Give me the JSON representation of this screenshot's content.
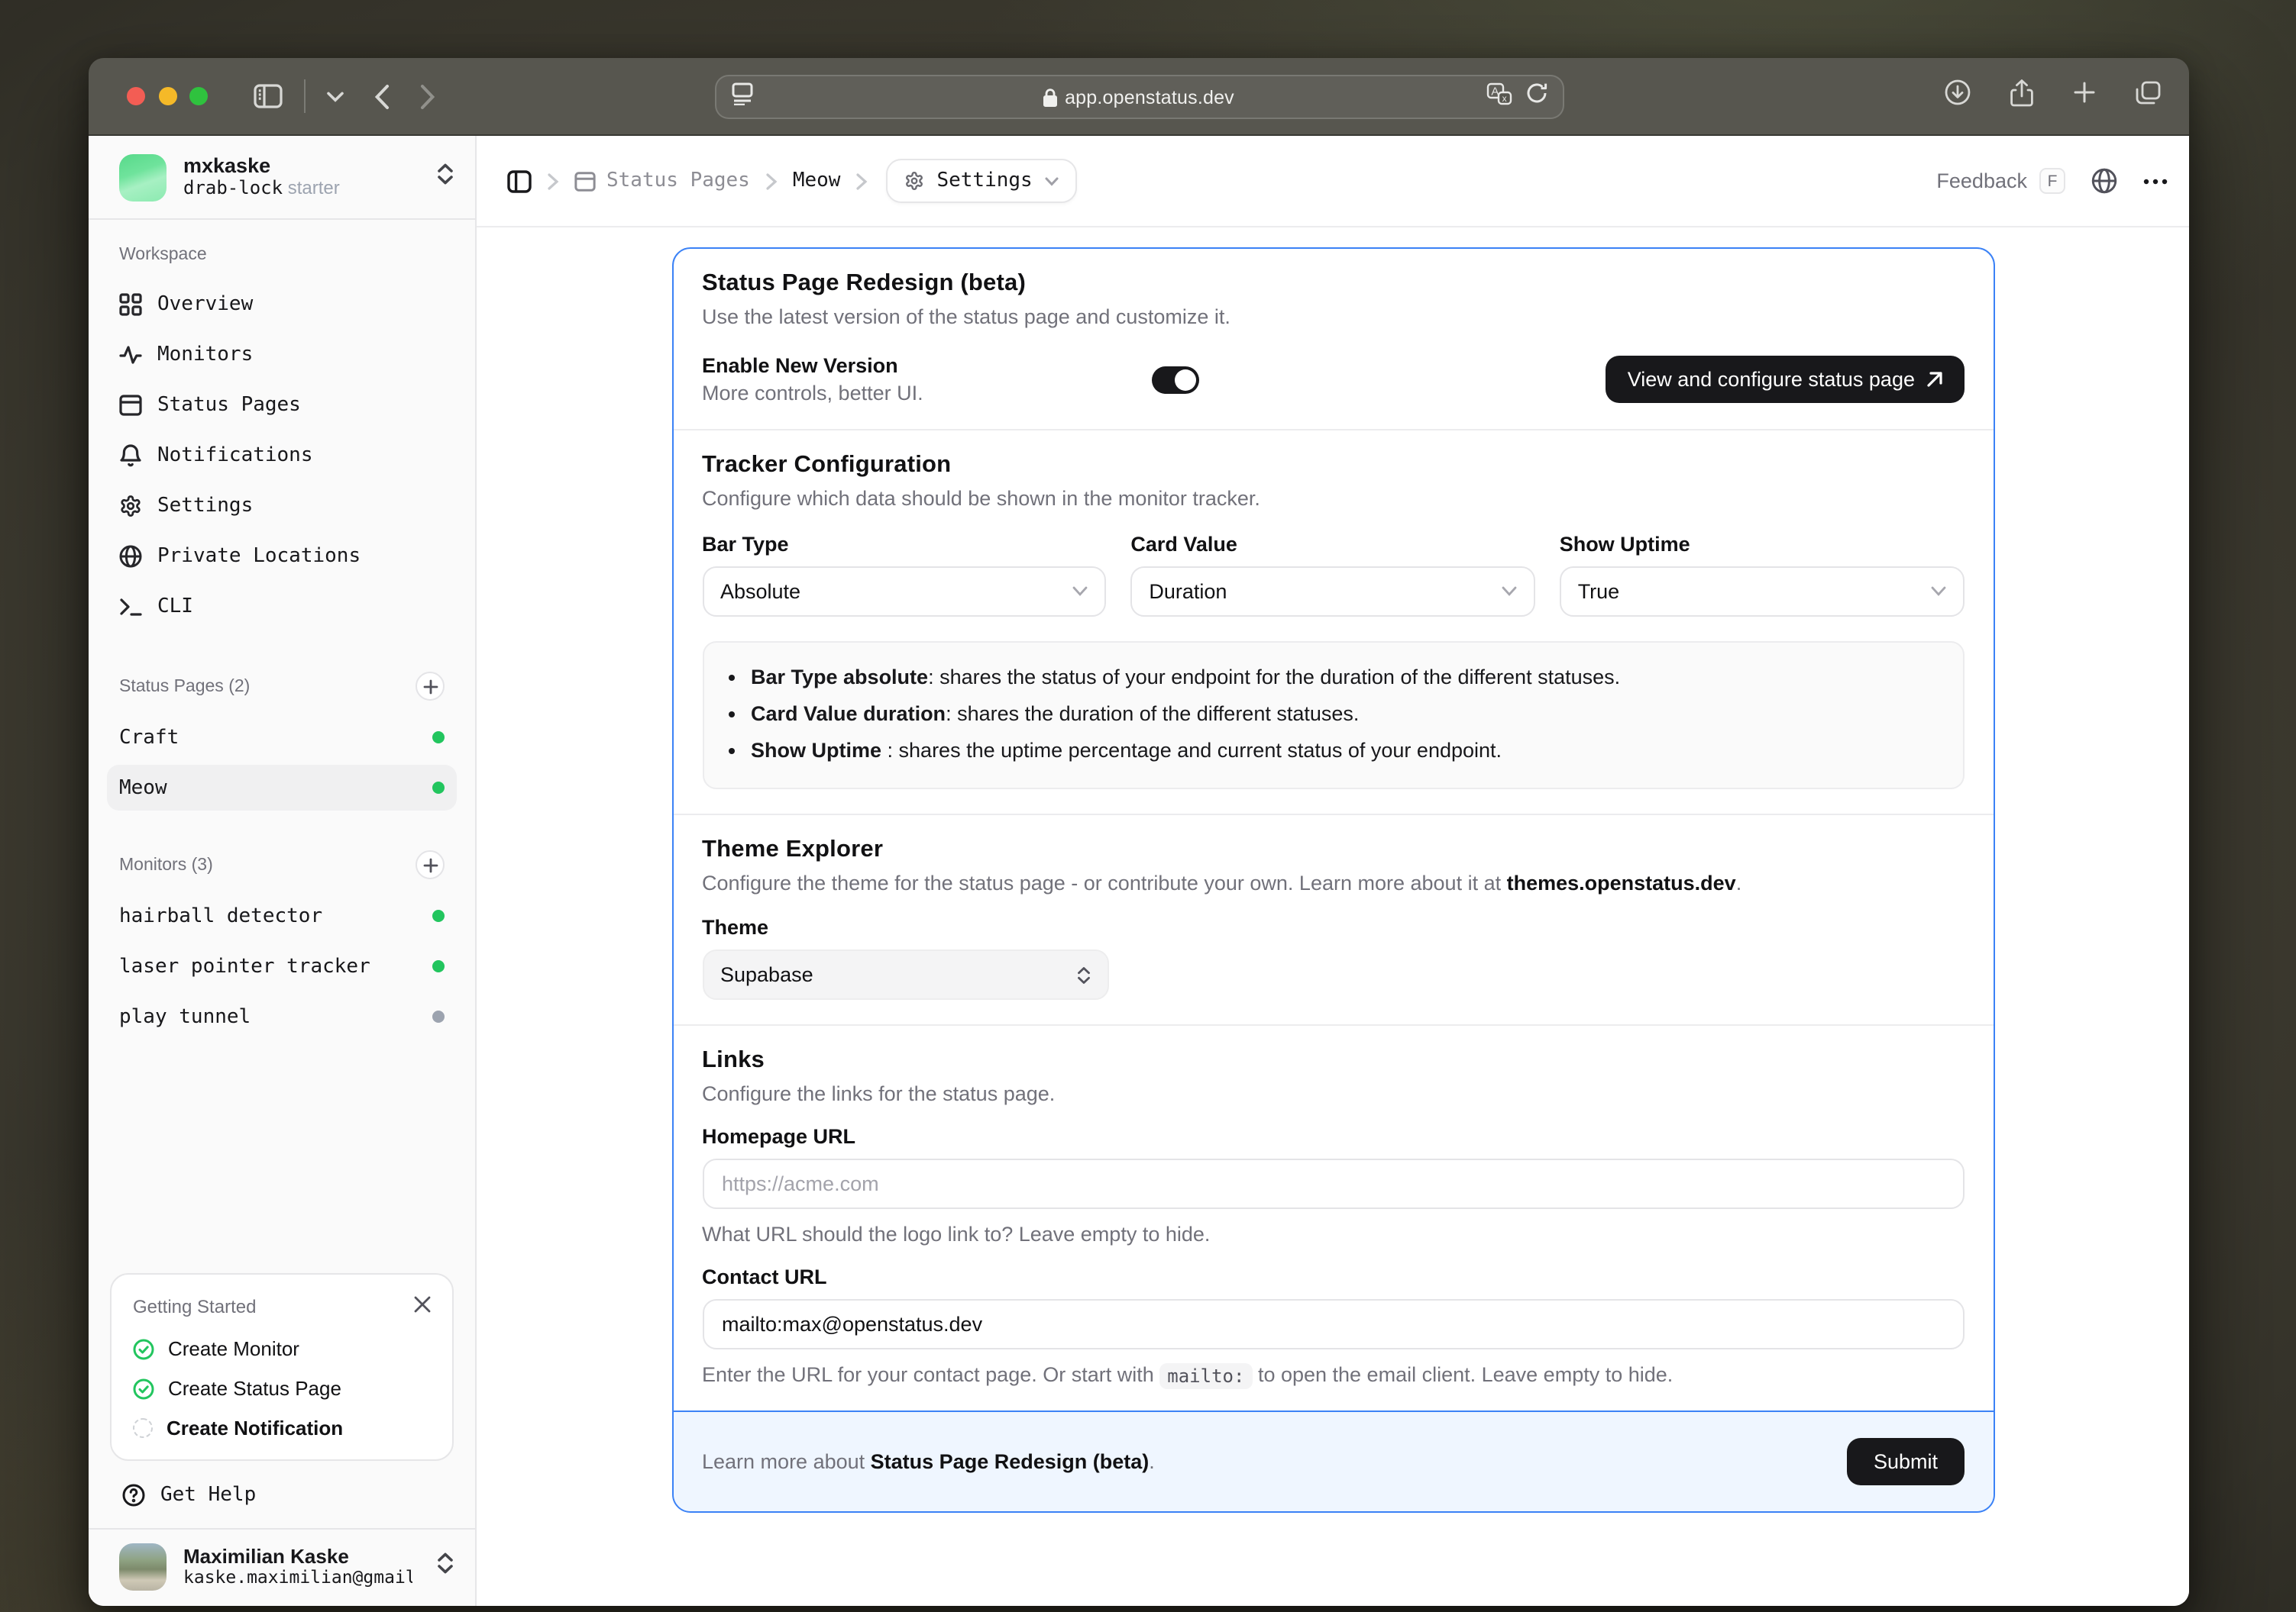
{
  "colors": {
    "accent_blue": "#3b82f6",
    "status_green": "#22c55e",
    "status_gray": "#9ca3af",
    "button_dark": "#18181b",
    "footer_bg": "#eff6ff"
  },
  "browser": {
    "domain": "app.openstatus.dev"
  },
  "sidebar": {
    "team": {
      "name": "mxkaske",
      "project": "drab-lock",
      "plan": "starter"
    },
    "workspace_label": "Workspace",
    "workspace_items": [
      {
        "label": "Overview"
      },
      {
        "label": "Monitors"
      },
      {
        "label": "Status Pages"
      },
      {
        "label": "Notifications"
      },
      {
        "label": "Settings"
      },
      {
        "label": "Private Locations"
      },
      {
        "label": "CLI"
      }
    ],
    "status_pages": {
      "label": "Status Pages",
      "count": "(2)",
      "items": [
        {
          "label": "Craft",
          "status": "operational"
        },
        {
          "label": "Meow",
          "status": "operational",
          "selected": true
        }
      ]
    },
    "monitors": {
      "label": "Monitors",
      "count": "(3)",
      "items": [
        {
          "label": "hairball detector",
          "status": "active"
        },
        {
          "label": "laser pointer tracker",
          "status": "active"
        },
        {
          "label": "play tunnel",
          "status": "inactive"
        }
      ]
    },
    "getting_started": {
      "title": "Getting Started",
      "items": [
        {
          "label": "Create Monitor",
          "done": true
        },
        {
          "label": "Create Status Page",
          "done": true
        },
        {
          "label": "Create Notification",
          "done": false
        }
      ]
    },
    "get_help": "Get Help",
    "user": {
      "name": "Maximilian Kaske",
      "email": "kaske.maximilian@gmail…"
    }
  },
  "header": {
    "breadcrumb": {
      "section": "Status Pages",
      "page": "Meow",
      "current": "Settings"
    },
    "feedback_label": "Feedback",
    "feedback_key": "F"
  },
  "main": {
    "redesign": {
      "title": "Status Page Redesign (beta)",
      "description": "Use the latest version of the status page and customize it.",
      "toggle_label": "Enable New Version",
      "toggle_sub": "More controls, better UI.",
      "toggle_on": true,
      "cta": "View and configure status page"
    },
    "tracker": {
      "title": "Tracker Configuration",
      "description": "Configure which data should be shown in the monitor tracker.",
      "fields": [
        {
          "label": "Bar Type",
          "value": "Absolute"
        },
        {
          "label": "Card Value",
          "value": "Duration"
        },
        {
          "label": "Show Uptime",
          "value": "True"
        }
      ],
      "bullets": [
        {
          "bold": "Bar Type absolute",
          "rest": ": shares the status of your endpoint for the duration of the different statuses."
        },
        {
          "bold": "Card Value duration",
          "rest": ": shares the duration of the different statuses."
        },
        {
          "bold": "Show Uptime",
          "rest": " : shares the uptime percentage and current status of your endpoint."
        }
      ]
    },
    "theme": {
      "title": "Theme Explorer",
      "desc_prefix": "Configure the theme for the status page - or contribute your own. Learn more about it at ",
      "desc_link": "themes.openstatus.dev",
      "desc_suffix": ".",
      "label": "Theme",
      "value": "Supabase"
    },
    "links": {
      "title": "Links",
      "description": "Configure the links for the status page.",
      "homepage": {
        "label": "Homepage URL",
        "placeholder": "https://acme.com",
        "hint": "What URL should the logo link to? Leave empty to hide."
      },
      "contact": {
        "label": "Contact URL",
        "value": "mailto:max@openstatus.dev",
        "hint_prefix": "Enter the URL for your contact page. Or start with ",
        "hint_code": "mailto:",
        "hint_suffix": " to open the email client. Leave empty to hide."
      }
    },
    "footer": {
      "text_prefix": "Learn more about ",
      "text_bold": "Status Page Redesign (beta)",
      "text_suffix": ".",
      "submit": "Submit"
    }
  }
}
